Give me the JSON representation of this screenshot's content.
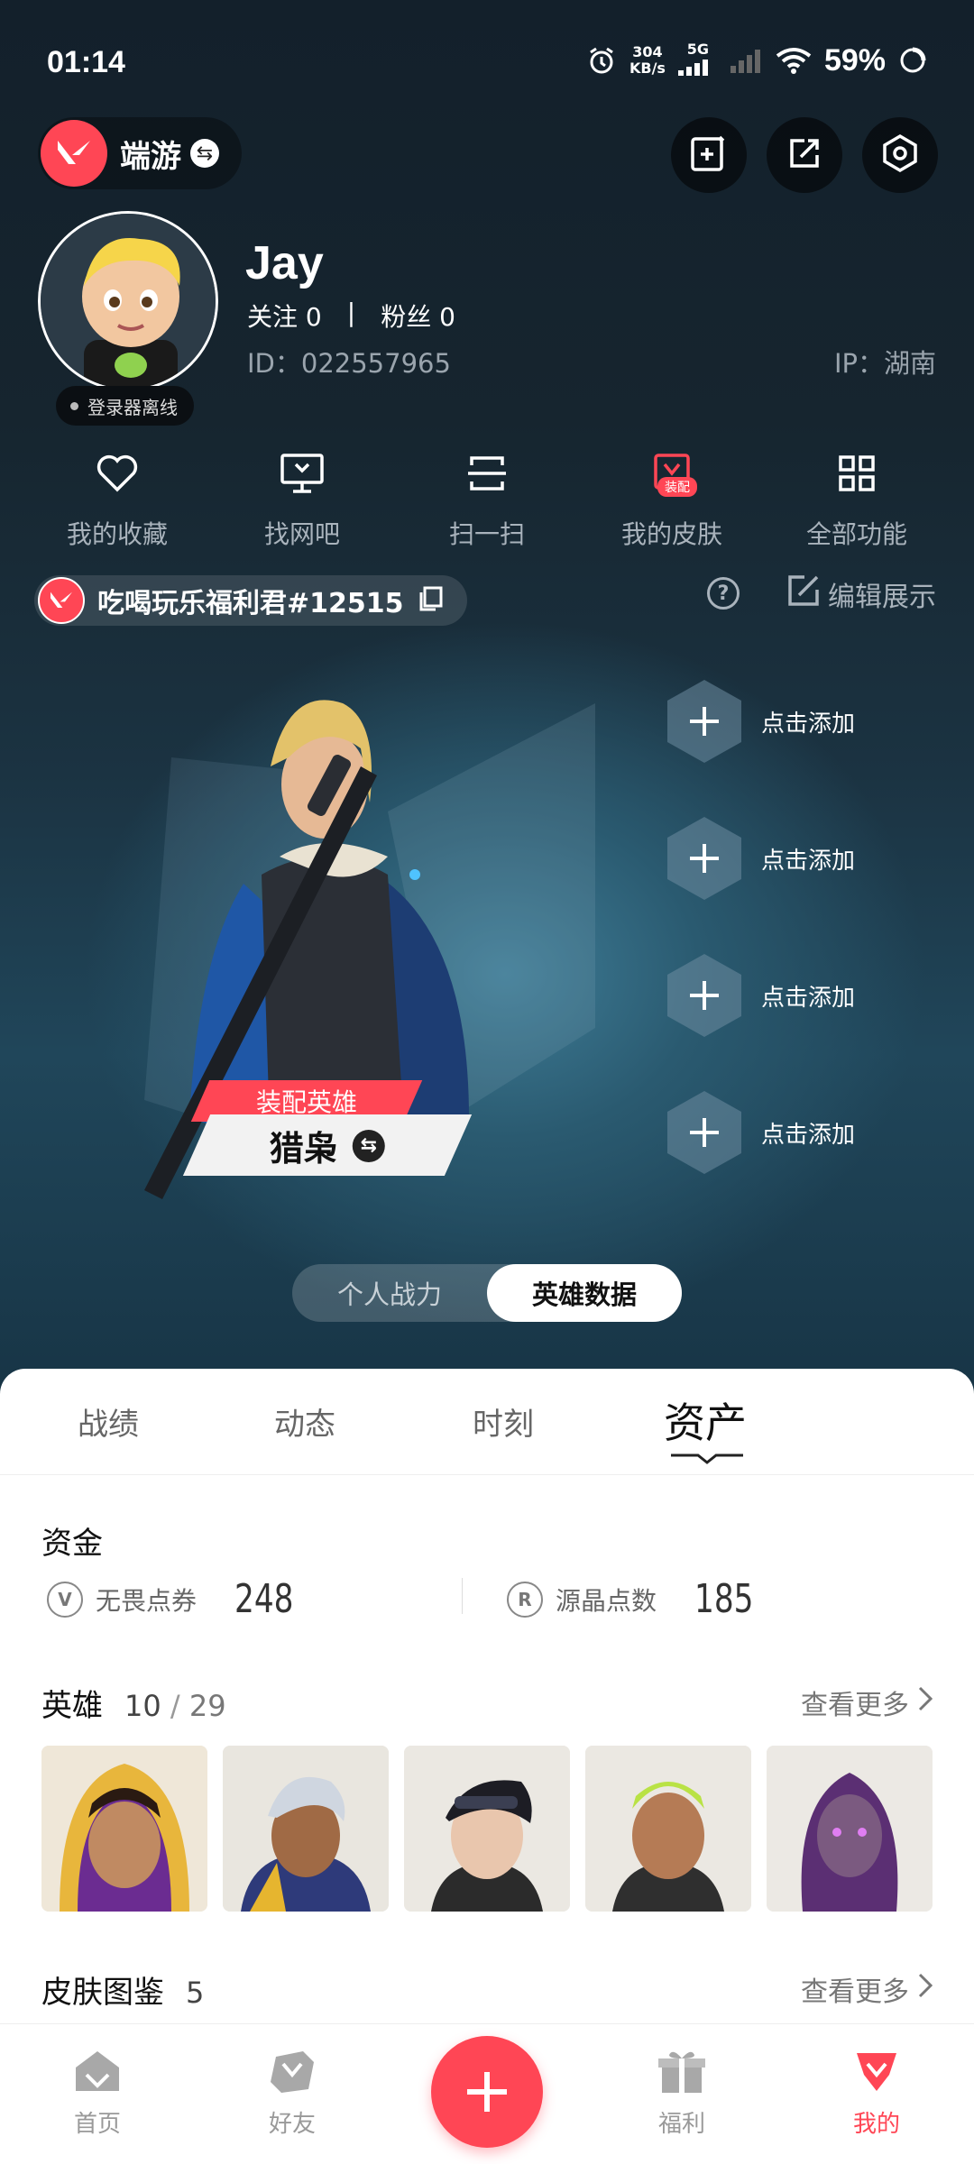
{
  "status_bar": {
    "time": "01:14",
    "speed_value": "304",
    "speed_unit": "KB/s",
    "network": "5G",
    "battery": "59%"
  },
  "header": {
    "game_name": "端游"
  },
  "profile": {
    "username": "Jay",
    "following_label": "关注",
    "following_count": "0",
    "separator": "|",
    "followers_label": "粉丝",
    "followers_count": "0",
    "id_text": "ID：022557965",
    "ip_text": "IP：湖南",
    "login_status": "登录器离线"
  },
  "shortcuts": [
    {
      "label": "我的收藏",
      "icon": "heart-icon"
    },
    {
      "label": "找网吧",
      "icon": "monitor-icon"
    },
    {
      "label": "扫一扫",
      "icon": "scan-icon"
    },
    {
      "label": "我的皮肤",
      "icon": "skin-icon",
      "badge": "装配"
    },
    {
      "label": "全部功能",
      "icon": "grid-icon"
    }
  ],
  "riot_account": {
    "name": "吃喝玩乐福利君#12515",
    "edit_label": "编辑展示"
  },
  "showcase": {
    "equip_tag": "装配英雄",
    "agent_name": "猎枭",
    "slots": [
      "点击添加",
      "点击添加",
      "点击添加",
      "点击添加"
    ],
    "toggle": [
      "个人战力",
      "英雄数据"
    ],
    "toggle_active": 1
  },
  "tabs": {
    "items": [
      "战绩",
      "动态",
      "时刻",
      "资产"
    ],
    "active": 3
  },
  "funds": {
    "title": "资金",
    "items": [
      {
        "label": "无畏点券",
        "value": "248",
        "icon": "valorant-points-icon"
      },
      {
        "label": "源晶点数",
        "value": "185",
        "icon": "radianite-icon"
      }
    ]
  },
  "heroes": {
    "title": "英雄",
    "owned": "10",
    "slash": "/",
    "total": "29",
    "more_label": "查看更多"
  },
  "skins": {
    "title": "皮肤图鉴",
    "count": "5",
    "more_label": "查看更多"
  },
  "bottom_nav": {
    "items": [
      "首页",
      "好友",
      "福利",
      "我的"
    ],
    "active": 3
  },
  "colors": {
    "accent": "#ff4655",
    "dark_bg": "#13202b"
  }
}
